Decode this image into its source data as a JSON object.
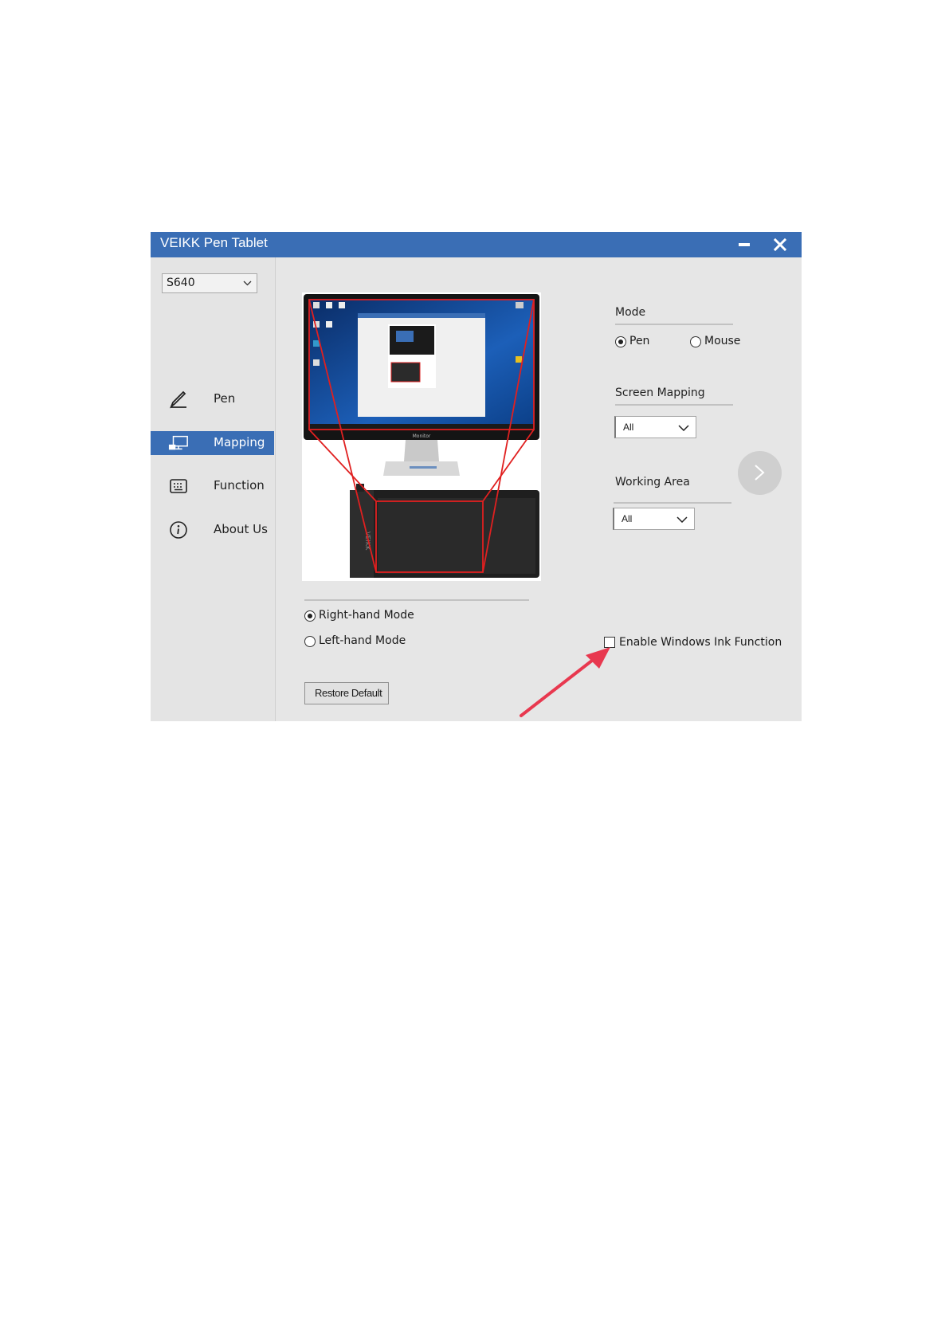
{
  "window": {
    "title": "VEIKK Pen Tablet"
  },
  "device_select": {
    "value": "S640"
  },
  "sidebar": {
    "items": [
      {
        "label": "Pen",
        "icon": "pen-icon",
        "active": false
      },
      {
        "label": "Mapping",
        "icon": "monitor-icon",
        "active": true
      },
      {
        "label": "Function",
        "icon": "keyboard-icon",
        "active": false
      },
      {
        "label": "About Us",
        "icon": "info-icon",
        "active": false
      }
    ]
  },
  "mode": {
    "label": "Mode",
    "options": [
      "Pen",
      "Mouse"
    ],
    "selected": "Pen"
  },
  "screen_mapping": {
    "label": "Screen Mapping",
    "value": "All"
  },
  "working_area": {
    "label": "Working Area",
    "value": "All"
  },
  "hand_mode": {
    "options": [
      "Right-hand Mode",
      "Left-hand Mode"
    ],
    "selected": "Right-hand Mode"
  },
  "windows_ink": {
    "label": "Enable Windows Ink Function",
    "checked": false
  },
  "restore_button": {
    "label": "Restore Default"
  },
  "monitor_brand": "Monitor",
  "tablet_brand": "VEIKK",
  "colors": {
    "titlebar": "#3a6eb5",
    "active_nav": "#3a6eb5",
    "annotation_arrow": "#e8384f",
    "mapping_outline": "#e02020"
  }
}
